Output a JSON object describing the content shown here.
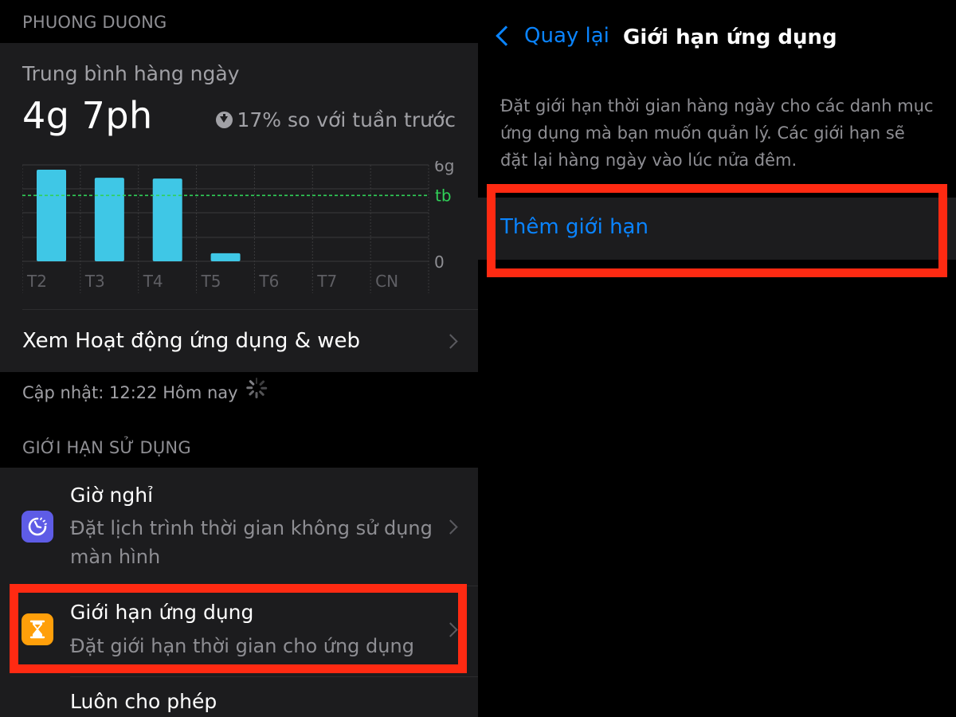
{
  "left_panel": {
    "user_header": "PHUONG DUONG",
    "summary": {
      "avg_label": "Trung bình hàng ngày",
      "avg_value": "4g 7ph",
      "trend_text": "17% so với tuần trước",
      "trend_icon": "down-arrow-circle-icon"
    },
    "activity_row_label": "Xem Hoạt động ứng dụng & web",
    "updated_text": "Cập nhật: 12:22 Hôm nay",
    "limits_header": "GIỚI HẠN SỬ DỤNG",
    "rows": {
      "downtime": {
        "title": "Giờ nghỉ",
        "subtitle": "Đặt lịch trình thời gian không sử dụng màn hình",
        "icon": "downtime-icon",
        "icon_color": "#5e5ce6"
      },
      "app_limits": {
        "title": "Giới hạn ứng dụng",
        "subtitle": "Đặt giới hạn thời gian cho ứng dụng",
        "icon": "hourglass-icon",
        "icon_color": "#ff9f0a"
      },
      "always_allowed": {
        "title": "Luôn cho phép"
      }
    }
  },
  "right_panel": {
    "back_label": "Quay lại",
    "nav_title": "Giới hạn ứng dụng",
    "description": "Đặt giới hạn thời gian hàng ngày cho các danh mục ứng dụng mà bạn muốn quản lý. Các giới hạn sẽ đặt lại hàng ngày vào lúc nửa đêm.",
    "add_limit_label": "Thêm giới hạn"
  },
  "colors": {
    "accent_blue": "#0a84ff",
    "bar": "#3fc7e6",
    "average_line": "#30d158",
    "highlight": "#ff2a12"
  },
  "chart_data": {
    "type": "bar",
    "categories": [
      "T2",
      "T3",
      "T4",
      "T5",
      "T6",
      "T7",
      "CN"
    ],
    "values": [
      5.7,
      5.2,
      5.15,
      0.5,
      0,
      0,
      0
    ],
    "average": 4.1,
    "average_label": "tb",
    "y_tick_labels": [
      "6g",
      "0"
    ],
    "ylim": [
      0,
      6
    ],
    "grid": true
  }
}
